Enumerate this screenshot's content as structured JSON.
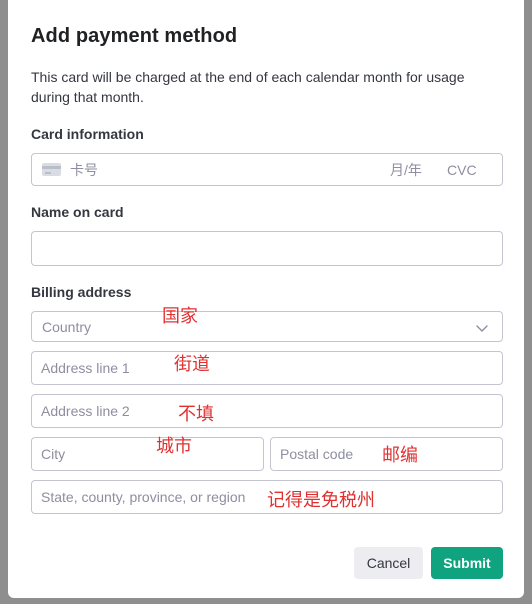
{
  "modal": {
    "title": "Add payment method",
    "description": "This card will be charged at the end of each calendar month for usage during that month."
  },
  "card_info": {
    "label": "Card information",
    "number_placeholder": "卡号",
    "expiry_placeholder": "月/年",
    "cvc_placeholder": "CVC",
    "icon": "credit-card-icon"
  },
  "name_on_card": {
    "label": "Name on card",
    "value": ""
  },
  "billing": {
    "label": "Billing address",
    "country_placeholder": "Country",
    "address1_placeholder": "Address line 1",
    "address2_placeholder": "Address line 2",
    "city_placeholder": "City",
    "postal_placeholder": "Postal code",
    "state_placeholder": "State, county, province, or region"
  },
  "annotations": {
    "country": "国家",
    "address1": "街道",
    "address2": "不填",
    "city": "城市",
    "postal": "邮编",
    "state": "记得是免税州"
  },
  "buttons": {
    "cancel": "Cancel",
    "submit": "Submit"
  },
  "colors": {
    "accent": "#10a37f",
    "annotation": "#e03131"
  }
}
